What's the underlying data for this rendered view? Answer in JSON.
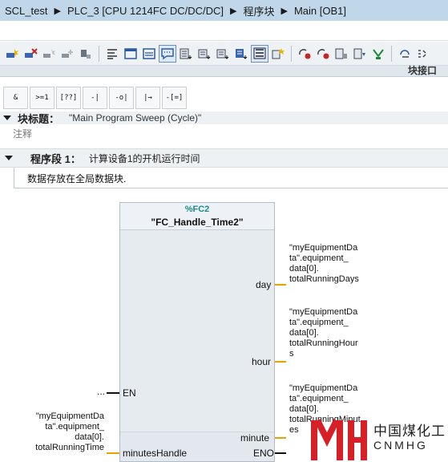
{
  "breadcrumb": {
    "project": "SCL_test",
    "device": "PLC_3 [CPU 1214FC DC/DC/DC]",
    "folder": "程序块",
    "block": "Main [OB1]"
  },
  "toolbar": {
    "icons": [
      "insert-network-icon",
      "delete-network-icon",
      "insert-row-icon",
      "add-row-icon",
      "reset-icon",
      "abs-op-icon",
      "block-interface-icon",
      "list-icon",
      "comment-icon",
      "favorites-icon",
      "download-icon",
      "monitor-icon",
      "tag-info-icon",
      "absolute-list-icon",
      "set-star-icon",
      "goto-icon",
      "stop-monitor-icon",
      "compare-icon",
      "debug-icon",
      "status-icon",
      "more-icon"
    ]
  },
  "interface_bar": {
    "label": "块接口"
  },
  "instructions": [
    "&",
    ">=1",
    "[??]",
    "-|",
    "-o|",
    "|→",
    "-[=]"
  ],
  "block_title": {
    "label": "块标题：",
    "text": "\"Main Program Sweep (Cycle)\"",
    "comment": "注释"
  },
  "network": {
    "label": "程序段 1：",
    "title": "计算设备1的开机运行时间",
    "comment": "数据存放在全局数据块."
  },
  "function_block": {
    "instance": "%FC2",
    "name": "\"FC_Handle_Time2\"",
    "inputs": {
      "en": "EN",
      "en_operand": "...",
      "minutes_handle": "minutesHandle",
      "minutes_operand": [
        "\"myEquipmentDa",
        "ta\".equipment_",
        "data[0].",
        "totalRunningTime"
      ]
    },
    "outputs": {
      "day": "day",
      "day_operand": [
        "\"myEquipmentDa",
        "ta\".equipment_",
        "data[0].",
        "totalRunningDays"
      ],
      "hour": "hour",
      "hour_operand": [
        "\"myEquipmentDa",
        "ta\".equipment_",
        "data[0].",
        "totalRunningHour",
        "s"
      ],
      "minute": "minute",
      "minute_operand": [
        "\"myEquipmentDa",
        "ta\".equipment_",
        "data[0].",
        "totalRunningMinut",
        "es"
      ],
      "eno": "ENO"
    }
  },
  "watermark": {
    "cn": "中国煤化工",
    "en": "CNMHG"
  },
  "colors": {
    "titlebar": "#bfd7e8",
    "instance": "#1d8a8a",
    "wire": "#f0a000",
    "watermark": "#d61f26"
  }
}
